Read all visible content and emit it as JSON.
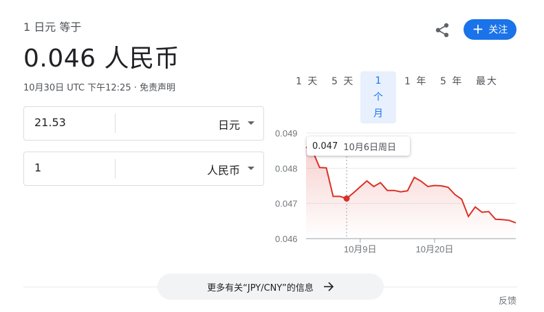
{
  "header": {
    "subtitle": "1 日元 等于",
    "rate": "0.046 人民币",
    "meta": "10月30日 UTC 下午12:25 · 免责声明",
    "share_icon": "share-icon",
    "follow_label": "关注",
    "follow_color": "#1a73e8"
  },
  "converter": {
    "from": {
      "value": "21.53",
      "unit": "日元"
    },
    "to": {
      "value": "1",
      "unit": "人民币"
    }
  },
  "ranges": {
    "items": [
      "1 天",
      "5 天",
      "1 个月",
      "1 年",
      "5 年",
      "最大"
    ],
    "active": "1 个月"
  },
  "tooltip": {
    "value": "0.047",
    "date": "10月6日周日"
  },
  "chart_data": {
    "type": "line",
    "title": "",
    "xlabel": "",
    "ylabel": "",
    "ylim": [
      0.046,
      0.049
    ],
    "yticks": [
      "0.049",
      "0.048",
      "0.047",
      "0.046"
    ],
    "xticks": [
      "10月9日",
      "10月20日"
    ],
    "grid": true,
    "line_color": "#d93025",
    "series": [
      {
        "values": [
          0.0486,
          0.04848,
          0.04802,
          0.04801,
          0.0472,
          0.0472,
          0.04714,
          0.0473,
          0.04747,
          0.04764,
          0.04748,
          0.04759,
          0.04737,
          0.04737,
          0.04733,
          0.04736,
          0.04774,
          0.04763,
          0.04748,
          0.04751,
          0.0475,
          0.04746,
          0.04725,
          0.04712,
          0.04663,
          0.0469,
          0.04675,
          0.04677,
          0.04655,
          0.04654,
          0.04652,
          0.04645
        ]
      }
    ],
    "highlight": {
      "value": 0.04714,
      "label": "0.047",
      "date": "10月6日周日"
    }
  },
  "footer": {
    "more_label": "更多有关“JPY/CNY”的信息",
    "feedback": "反馈"
  }
}
